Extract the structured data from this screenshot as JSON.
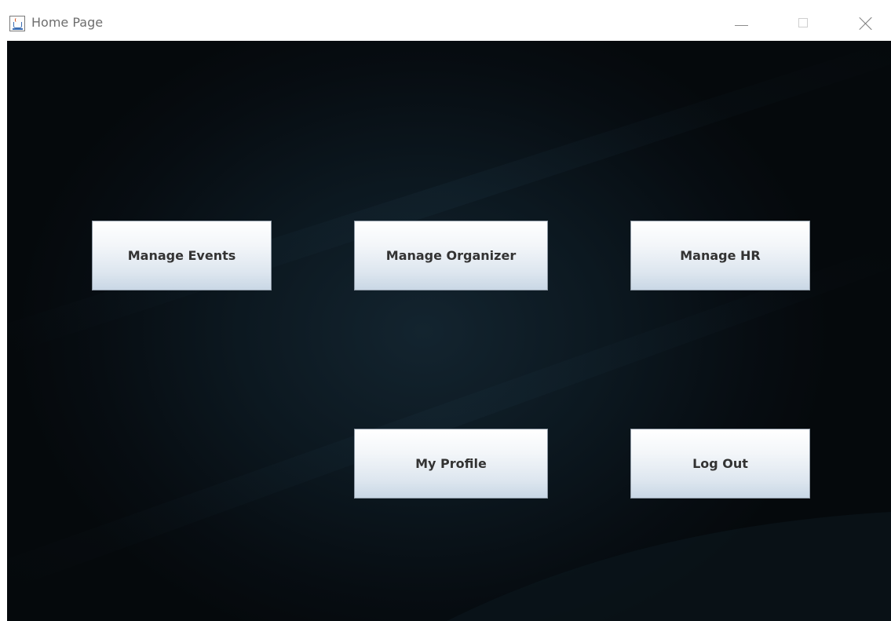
{
  "window": {
    "title": "Home Page",
    "icon": "java-cup-icon",
    "controls": {
      "minimize_icon": "minimize-icon",
      "maximize_icon": "maximize-icon",
      "close_icon": "close-icon"
    }
  },
  "main": {
    "buttons": {
      "manage_events": "Manage Events",
      "manage_organizer": "Manage Organizer",
      "manage_hr": "Manage HR",
      "my_profile": "My Profile",
      "log_out": "Log Out"
    }
  },
  "colors": {
    "background_dark": "#070d12",
    "background_center": "#13242f",
    "button_top": "#ffffff",
    "button_bottom": "#c9d7e5",
    "button_text": "#333333"
  }
}
